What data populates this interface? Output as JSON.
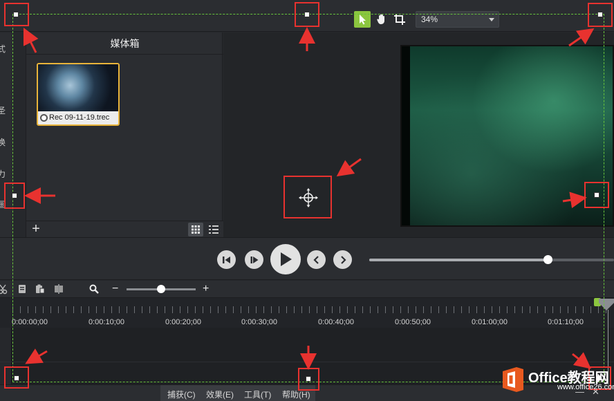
{
  "toolbar": {
    "tools": [
      {
        "name": "select",
        "icon": "pointer-icon",
        "active": true
      },
      {
        "name": "pan",
        "icon": "hand-icon",
        "active": false
      },
      {
        "name": "crop",
        "icon": "crop-icon",
        "active": false
      }
    ],
    "zoom_value": "34%",
    "accent_color": "#8cc63f"
  },
  "left_panel": {
    "partial_labels": [
      "式",
      "圣",
      "换",
      "力",
      "画"
    ]
  },
  "media_bin": {
    "title": "媒体箱",
    "clips": [
      {
        "label": "Rec 09-11-19.trec",
        "selected": true,
        "thumbnail": "screen-recording-thumbnail"
      }
    ],
    "view_mode": "grid"
  },
  "playback": {
    "buttons": [
      "step-back-icon",
      "step-forward-icon",
      "play-icon",
      "prev-marker-icon",
      "next-marker-icon"
    ],
    "scrub_fraction": 0.73
  },
  "timeline_toolbar": {
    "icons": [
      "cut-icon",
      "copy-icon",
      "paste-icon",
      "split-icon",
      "zoom-search-icon",
      "zoom-out-icon",
      "zoom-in-icon"
    ],
    "minus": "−",
    "plus": "+",
    "zoom_fraction": 0.5
  },
  "ruler": {
    "labels": [
      "0:00:00;00",
      "0:00:10;00",
      "0:00:20;00",
      "0:00:30;00",
      "0:00:40;00",
      "0:00:50;00",
      "0:01:00;00",
      "0:01:10;00"
    ]
  },
  "menu": {
    "items": [
      "捕获(C)",
      "效果(E)",
      "工具(T)",
      "帮助(H)"
    ]
  },
  "watermark": {
    "brand": "Office教程网",
    "url": "www.office26.com"
  },
  "colors": {
    "selection_dash": "#67c33c",
    "annotation_red": "#e8322f",
    "clip_border": "#e9b43a"
  }
}
